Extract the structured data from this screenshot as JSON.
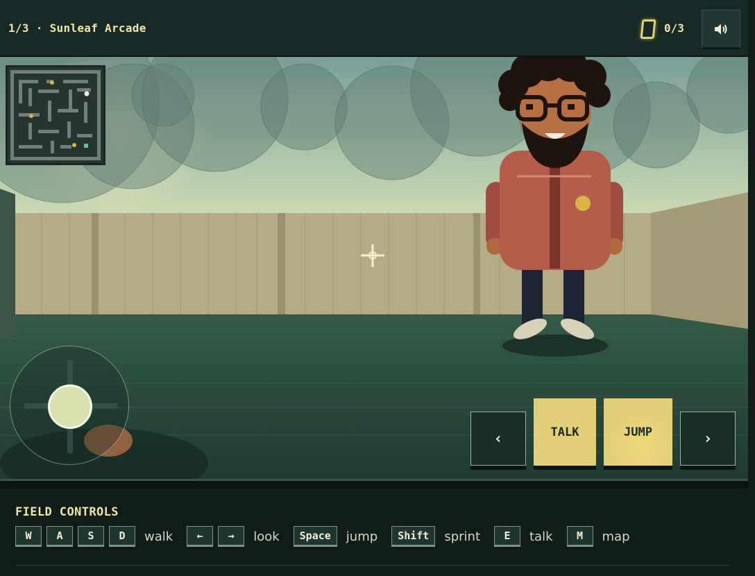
{
  "header": {
    "level_title": "1/3 · Sunleaf Arcade",
    "cards_count": "0/3",
    "sound_icon": "speaker-icon"
  },
  "controls_panel": {
    "title": "FIELD CONTROLS",
    "groups": [
      {
        "keys": [
          "W",
          "A",
          "S",
          "D"
        ],
        "action": "walk"
      },
      {
        "keys": [
          "←",
          "→"
        ],
        "action": "look"
      },
      {
        "keys": [
          "Space"
        ],
        "action": "jump"
      },
      {
        "keys": [
          "Shift"
        ],
        "action": "sprint"
      },
      {
        "keys": [
          "E"
        ],
        "action": "talk"
      },
      {
        "keys": [
          "M"
        ],
        "action": "map"
      }
    ]
  },
  "actions": {
    "prev_label": "‹",
    "talk_label": "TALK",
    "jump_label": "JUMP",
    "next_label": "›"
  },
  "colors": {
    "accent_gold": "#e2cd79",
    "panel_bg": "#0f1c18",
    "header_bg": "#172926"
  }
}
